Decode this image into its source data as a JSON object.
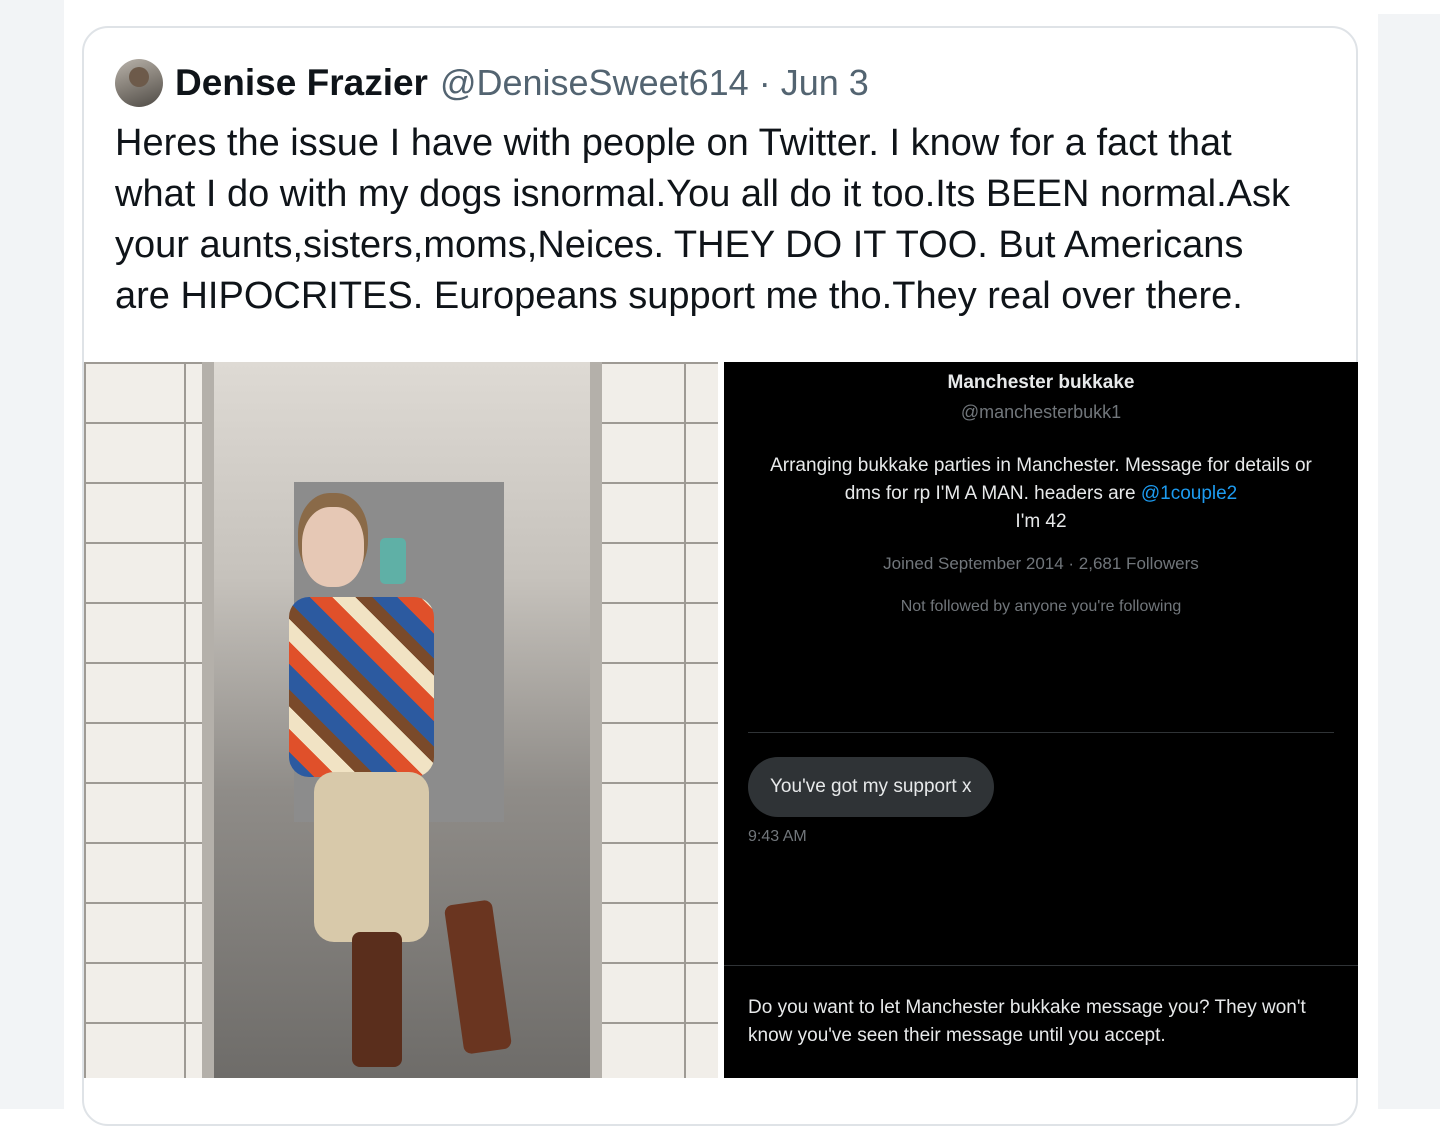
{
  "tweet": {
    "author_name": "Denise Frazier",
    "author_handle": "@DeniseSweet614",
    "separator": "·",
    "date": "Jun 3",
    "text": "Heres the issue I have with people on Twitter. I know for a fact that\nwhat I do with my dogs isnormal.You all do it too.Its BEEN normal.Ask\nyour aunts,sisters,moms,Neices.  THEY DO IT TOO. But Americans\nare HIPOCRITES. Europeans support me tho.They real over there."
  },
  "screenshot": {
    "profile_name": "Manchester bukkake",
    "profile_handle": "@manchesterbukk1",
    "bio_text": "Arranging bukkake parties in Manchester. Message for details or dms for rp I'M A MAN. headers are ",
    "bio_link": "@1couple2",
    "bio_tail": "I'm 42",
    "joined_followers": "Joined September 2014 · 2,681 Followers",
    "not_followed": "Not followed by anyone you're following",
    "message": "You've got my support x",
    "message_time": "9:43 AM",
    "request_prompt": "Do you want to let Manchester bukkake message you? They won't know you've seen their message until you accept."
  },
  "colors": {
    "text_primary": "#0f1419",
    "text_secondary": "#536471",
    "link_blue": "#1d9bf0",
    "dark_bg": "#000000",
    "bubble_bg": "#2f3336"
  }
}
